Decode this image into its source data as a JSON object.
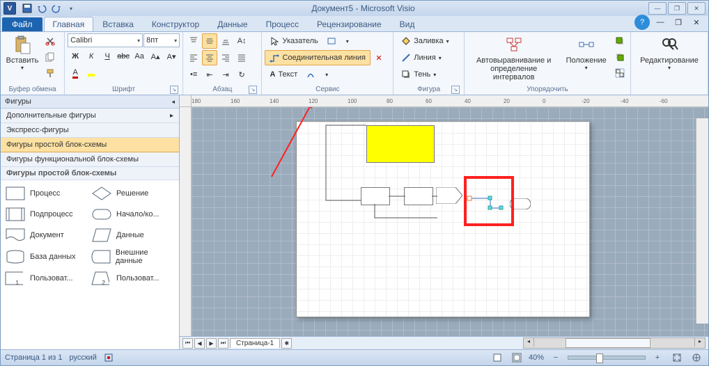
{
  "title": "Документ5 - Microsoft Visio",
  "file_tab": "Файл",
  "tabs": [
    "Главная",
    "Вставка",
    "Конструктор",
    "Данные",
    "Процесс",
    "Рецензирование",
    "Вид"
  ],
  "active_tab": 0,
  "ribbon": {
    "clipboard": {
      "label": "Буфер обмена",
      "paste": "Вставить"
    },
    "font": {
      "label": "Шрифт",
      "name": "Calibri",
      "size": "8пт"
    },
    "paragraph": {
      "label": "Абзац"
    },
    "tools": {
      "label": "Сервис",
      "pointer": "Указатель",
      "connector": "Соединительная линия",
      "text": "Текст"
    },
    "shape": {
      "label": "Фигура",
      "fill": "Заливка",
      "line": "Линия",
      "shadow": "Тень"
    },
    "arrange": {
      "label": "Упорядочить",
      "auto": "Автовыравнивание и определение интервалов",
      "position": "Положение"
    },
    "edit": {
      "label": "Редактирование"
    }
  },
  "shapes_pane": {
    "header": "Фигуры",
    "more": "Дополнительные фигуры",
    "quick": "Экспресс-фигуры",
    "cat_basic": "Фигуры простой блок-схемы",
    "cat_func": "Фигуры функциональной блок-схемы",
    "section": "Фигуры простой блок-схемы",
    "items": [
      {
        "a": "Процесс",
        "b": "Решение"
      },
      {
        "a": "Подпроцесс",
        "b": "Начало/ко..."
      },
      {
        "a": "Документ",
        "b": "Данные"
      },
      {
        "a": "База данных",
        "b": "Внешние данные"
      },
      {
        "a": "Пользоват...",
        "b": "Пользоват..."
      }
    ]
  },
  "page_tab": "Страница-1",
  "status": {
    "page": "Страница 1 из 1",
    "lang": "русский",
    "zoom": "40%"
  },
  "ruler_h": [
    "180",
    "160",
    "140",
    "120",
    "100",
    "80",
    "60",
    "40",
    "20",
    "0",
    "-20",
    "-40",
    "-60"
  ]
}
